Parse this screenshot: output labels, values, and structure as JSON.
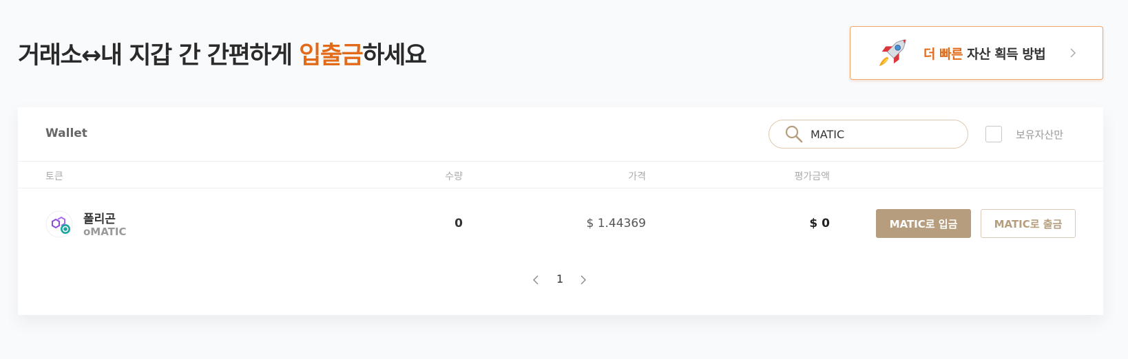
{
  "title": {
    "part1": "거래소↔내 지갑 간 간편하게 ",
    "accent": "입출금",
    "part2": "하세요",
    "accent_color": "#e26b1a"
  },
  "promo": {
    "icon": "rocket-icon",
    "accent": "더 빠른",
    "text": " 자산 획득 방법",
    "chevron_icon": "chevron-right-icon"
  },
  "wallet": {
    "title": "Wallet",
    "search": {
      "value": "MATIC",
      "icon": "search-icon"
    },
    "holdings_only_label": "보유자산만",
    "holdings_only_checked": false,
    "columns": {
      "token": "토큰",
      "amount": "수량",
      "price": "가격",
      "value": "평가금액"
    },
    "rows": [
      {
        "name": "폴리곤",
        "symbol": "oMATIC",
        "icon": "polygon-token-icon",
        "amount": "0",
        "price": "$ 1.44369",
        "value": "$ 0",
        "deposit_label": "MATIC로 입금",
        "withdraw_label": "MATIC로 출금"
      }
    ],
    "pagination": {
      "current": "1"
    }
  },
  "colors": {
    "brand_brown": "#b59d7e",
    "accent_orange": "#e26b1a",
    "background": "#f9fafc"
  }
}
